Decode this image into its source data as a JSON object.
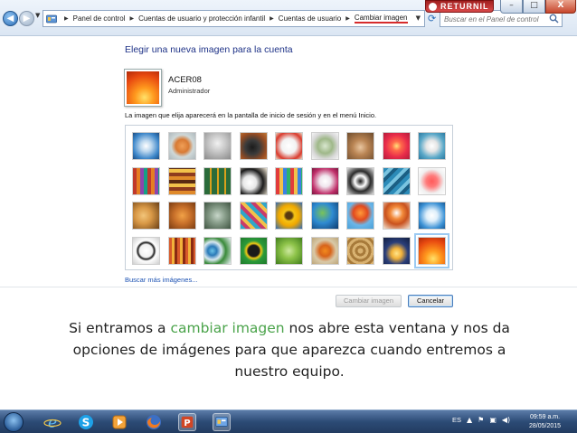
{
  "window": {
    "returnil_label": "RETURNIL",
    "controls": {
      "minimize": "–",
      "maximize": "□",
      "close": "X"
    }
  },
  "address_bar": {
    "crumbs": [
      "Panel de control",
      "Cuentas de usuario y protección infantil",
      "Cuentas de usuario",
      "Cambiar imagen"
    ],
    "search_placeholder": "Buscar en el Panel de control"
  },
  "page": {
    "title": "Elegir una nueva imagen para la cuenta",
    "user_name": "ACER08",
    "user_type": "Administrador",
    "description": "La imagen que elija aparecerá en la pantalla de inicio de sesión y en el menú Inicio.",
    "more_link": "Buscar más imágenes...",
    "buttons": {
      "change": "Cambiar imagen",
      "cancel": "Cancelar"
    }
  },
  "gallery": {
    "rows": 4,
    "columns": 9,
    "selected_index": 35,
    "pictures": [
      "wire-sphere",
      "starfish",
      "robot",
      "record-player",
      "lucky-cat",
      "globe",
      "kitten",
      "red-flower",
      "origami-sphere",
      "beads",
      "striped-fabric",
      "stone-grid",
      "dogs",
      "crayons",
      "white-flowers",
      "twisted-pattern",
      "stairs",
      "paper-crane",
      "guitar",
      "puppy",
      "toy-robot",
      "scarves",
      "sunflower",
      "earth",
      "hot-air-balloon",
      "mushroom",
      "sailboat",
      "soccer-ball",
      "woven-fabric",
      "marbles",
      "green-window",
      "leaf",
      "butterfly",
      "wicker",
      "lantern",
      "orange-flower"
    ]
  },
  "caption": {
    "before": "Si entramos a ",
    "highlight": "cambiar imagen",
    "after": " nos abre esta ventana y nos da opciones de imágenes para que aparezca cuando entremos a nuestro equipo.",
    "highlight_color": "#4aa34a"
  },
  "taskbar": {
    "language": "ES",
    "time": "09:59 a.m.",
    "date": "28/05/2015"
  },
  "colors": {
    "title": "#1e3287",
    "link": "#1c52b3",
    "breadcrumb_underline": "#d62b2b"
  }
}
